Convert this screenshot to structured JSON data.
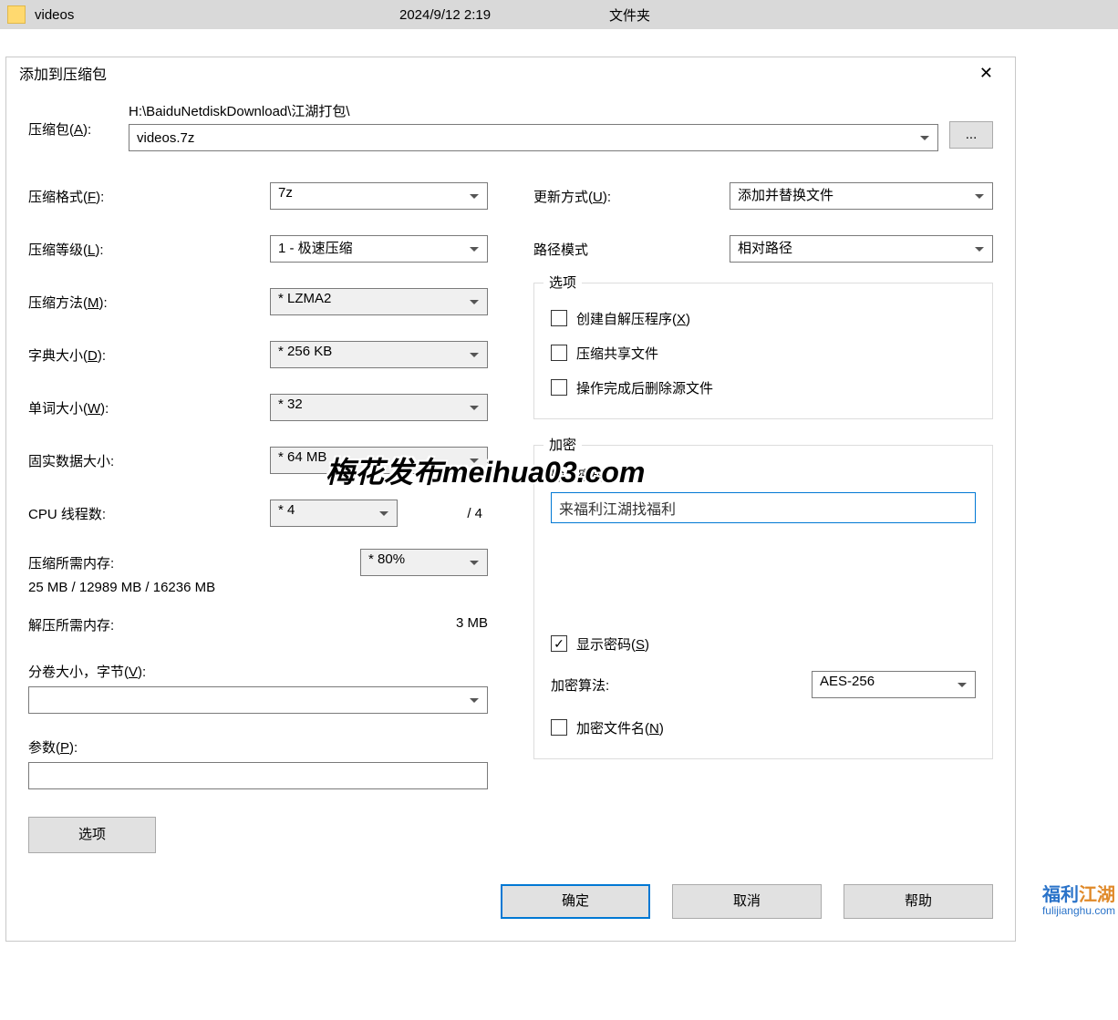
{
  "file_row": {
    "name": "videos",
    "date": "2024/9/12 2:19",
    "type": "文件夹"
  },
  "dialog": {
    "title": "添加到压缩包",
    "archive_label": "压缩包(A):",
    "archive_label_u": "A",
    "archive_path": "H:\\BaiduNetdiskDownload\\江湖打包\\",
    "archive_name": "videos.7z",
    "browse": "...",
    "left": {
      "format_lbl": "压缩格式(F):",
      "format_val": "7z",
      "level_lbl": "压缩等级(L):",
      "level_val": "1 - 极速压缩",
      "method_lbl": "压缩方法(M):",
      "method_val": "* LZMA2",
      "dict_lbl": "字典大小(D):",
      "dict_val": "* 256 KB",
      "word_lbl": "单词大小(W):",
      "word_val": "* 32",
      "solid_lbl": "固实数据大小:",
      "solid_val": "* 64 MB",
      "cpu_lbl": "CPU 线程数:",
      "cpu_val": "* 4",
      "cpu_total": "/ 4",
      "mem_comp_lbl": "压缩所需内存:",
      "mem_pct": "* 80%",
      "mem_comp_val": "25 MB / 12989 MB / 16236 MB",
      "mem_decomp_lbl": "解压所需内存:",
      "mem_decomp_val": "3 MB",
      "split_lbl": "分卷大小，字节(V):",
      "split_val": "",
      "params_lbl": "参数(P):",
      "params_val": "",
      "options_btn": "选项"
    },
    "right": {
      "update_lbl": "更新方式(U):",
      "update_val": "添加并替换文件",
      "path_lbl": "路径模式",
      "path_val": "相对路径",
      "opts": {
        "legend": "选项",
        "sfx": "创建自解压程序(X)",
        "shared": "压缩共享文件",
        "delete_after": "操作完成后删除源文件"
      },
      "enc": {
        "legend": "加密",
        "pwd_lbl": "输入密码:",
        "pwd_val": "来福利江湖找福利",
        "show_pwd": "显示密码(S)",
        "algo_lbl": "加密算法:",
        "algo_val": "AES-256",
        "enc_names": "加密文件名(N)"
      }
    },
    "buttons": {
      "ok": "确定",
      "cancel": "取消",
      "help": "帮助"
    }
  },
  "watermark": "梅花发布meihua03.com",
  "logo": {
    "line1a": "福利",
    "line1b": "江湖",
    "line2": "fulijianghu.com"
  }
}
